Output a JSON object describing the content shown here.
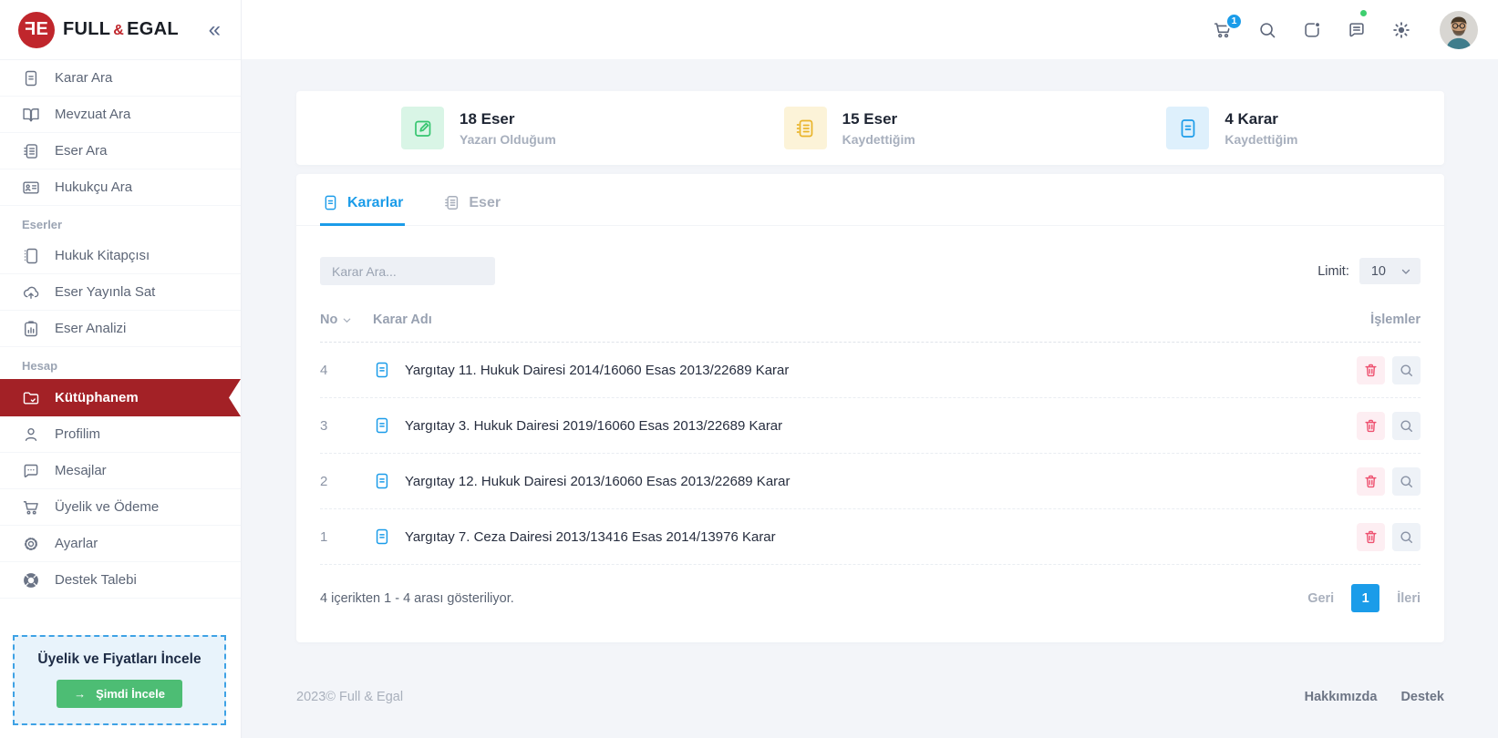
{
  "colors": {
    "brand_red": "#c0262c",
    "active_item_red": "#a32126",
    "accent_blue": "#1b9ce9",
    "promo_green": "#4dbd74",
    "stat_green": "#35c56f",
    "stat_yellow": "#e9b42a",
    "delete_pink": "#ee5270"
  },
  "brand": {
    "logo": {
      "f": "F",
      "e": "E"
    },
    "word1": "FULL",
    "amp": "&",
    "word2": "EGAL"
  },
  "header": {
    "collapse_glyph": "«",
    "cart_badge": "1"
  },
  "sidebar": {
    "sections": [
      {
        "label": "",
        "items": [
          {
            "label": "Karar Ara"
          },
          {
            "label": "Mevzuat Ara"
          },
          {
            "label": "Eser Ara"
          },
          {
            "label": "Hukukçu Ara"
          }
        ]
      },
      {
        "label": "Eserler",
        "items": [
          {
            "label": "Hukuk Kitapçısı"
          },
          {
            "label": "Eser Yayınla Sat"
          },
          {
            "label": "Eser Analizi"
          }
        ]
      },
      {
        "label": "Hesap",
        "items": [
          {
            "label": "Kütüphanem",
            "active": true
          },
          {
            "label": "Profilim"
          },
          {
            "label": "Mesajlar"
          },
          {
            "label": "Üyelik ve Ödeme"
          },
          {
            "label": "Ayarlar"
          },
          {
            "label": "Destek Talebi"
          }
        ]
      }
    ],
    "promo": {
      "title": "Üyelik ve Fiyatları İncele",
      "button_arrow": "→",
      "button_label": "Şimdi İncele"
    }
  },
  "stats": [
    {
      "value": "18 Eser",
      "label": "Yazarı Olduğum"
    },
    {
      "value": "15 Eser",
      "label": "Kaydettiğim"
    },
    {
      "value": "4 Karar",
      "label": "Kaydettiğim"
    }
  ],
  "tabs": [
    {
      "label": "Kararlar"
    },
    {
      "label": "Eser"
    }
  ],
  "toolbar": {
    "search_placeholder": "Karar Ara...",
    "limit_label": "Limit:",
    "limit_value": "10"
  },
  "table": {
    "headers": {
      "no": "No",
      "name": "Karar Adı",
      "actions": "İşlemler"
    },
    "rows": [
      {
        "no": "4",
        "title": "Yargıtay 11. Hukuk Dairesi 2014/16060 Esas 2013/22689 Karar"
      },
      {
        "no": "3",
        "title": "Yargıtay 3. Hukuk Dairesi 2019/16060 Esas 2013/22689 Karar"
      },
      {
        "no": "2",
        "title": "Yargıtay 12. Hukuk Dairesi 2013/16060 Esas 2013/22689 Karar"
      },
      {
        "no": "1",
        "title": "Yargıtay 7. Ceza Dairesi 2013/13416 Esas 2014/13976 Karar"
      }
    ],
    "summary": "4 içerikten 1 - 4 arası gösteriliyor."
  },
  "pagination": {
    "prev": "Geri",
    "current": "1",
    "next": "İleri"
  },
  "footer": {
    "copyright": "2023© Full & Egal",
    "links": [
      "Hakkımızda",
      "Destek"
    ]
  }
}
